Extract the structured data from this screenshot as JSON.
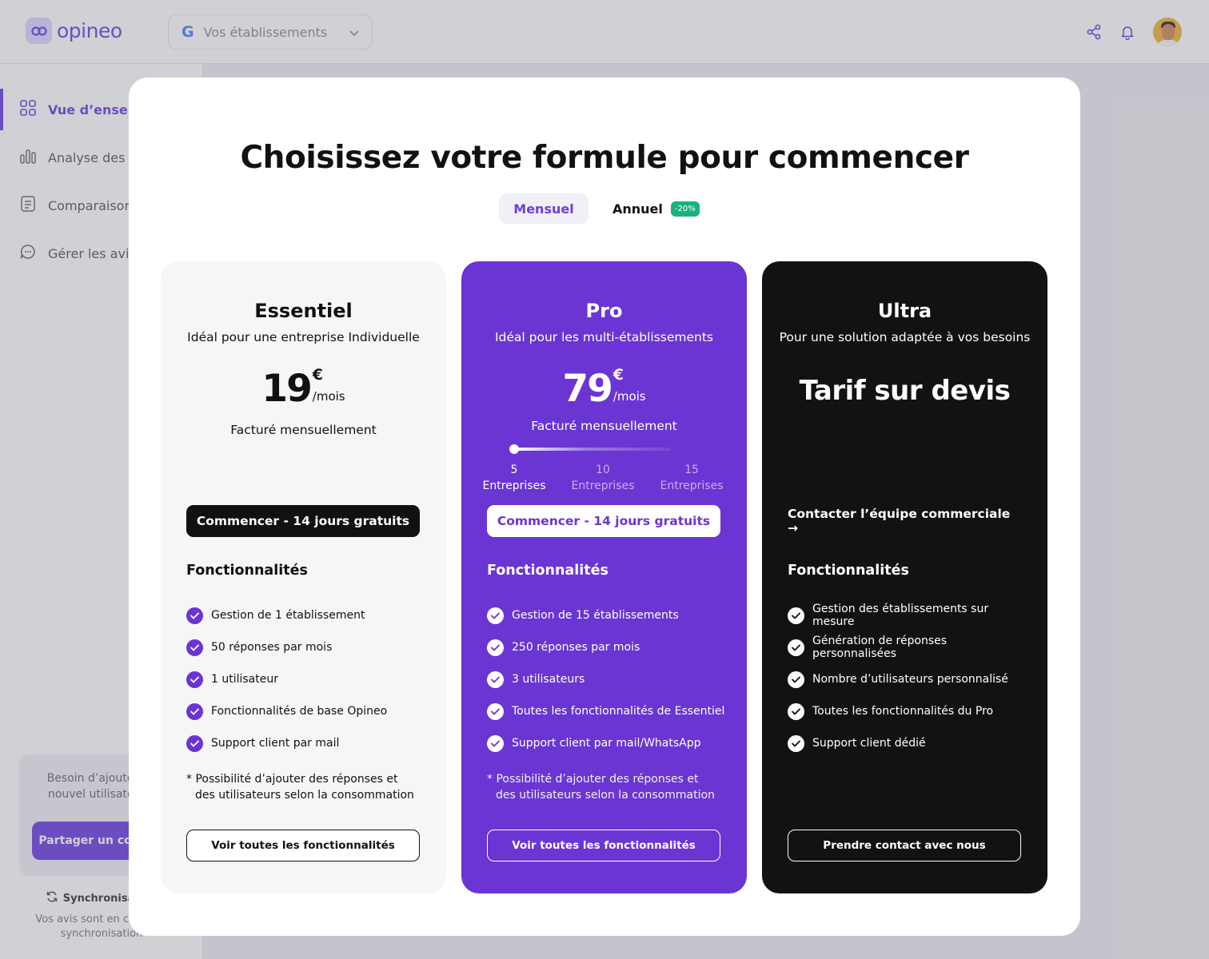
{
  "app": {
    "logo_text": "opineo",
    "establishment_select": {
      "placeholder": "Vos établissements",
      "icon": "google-icon"
    },
    "sidebar": {
      "items": [
        {
          "label": "Vue d’ensemble",
          "icon": "grid-icon",
          "active": true
        },
        {
          "label": "Analyse des avis",
          "icon": "bar-chart-icon",
          "active": false
        },
        {
          "label": "Comparaison",
          "icon": "document-icon",
          "active": false
        },
        {
          "label": "Gérer les avis",
          "icon": "chat-icon",
          "active": false
        }
      ],
      "help_card": {
        "text": "Besoin d’ajouter un nouvel utilisateur ?",
        "button": "Partager un compte"
      },
      "sync": {
        "title": "Synchronisation",
        "text": "Vos avis sont en cours de synchronisation"
      }
    }
  },
  "modal": {
    "title": "Choisissez votre formule pour commencer",
    "billing_toggle": {
      "monthly": "Mensuel",
      "yearly": "Annuel",
      "yearly_badge": "-20%",
      "selected": "Mensuel"
    },
    "plans": [
      {
        "name": "Essentiel",
        "description": "Idéal pour une entreprise Individuelle",
        "price": "19",
        "currency": "€",
        "period": "/mois",
        "billing": "Facturé mensuellement",
        "cta": "Commencer - 14 jours gratuits",
        "features_title": "Fonctionnalités",
        "features": [
          "Gestion de 1 établissement",
          "50 réponses par mois",
          "1 utilisateur",
          "Fonctionnalités de base Opineo",
          "Support client par mail"
        ],
        "note": "* Possibilité d’ajouter des réponses et des utilisateurs selon la consommation",
        "bottom_button": "Voir toutes les fonctionnalités"
      },
      {
        "name": "Pro",
        "description": "Idéal pour les multi-établissements",
        "price": "79",
        "currency": "€",
        "period": "/mois",
        "billing": "Facturé mensuellement",
        "slider": {
          "ticks": [
            {
              "value": "5",
              "label": "Entreprises"
            },
            {
              "value": "10",
              "label": "Entreprises"
            },
            {
              "value": "15",
              "label": "Entreprises"
            }
          ],
          "selected_index": 0
        },
        "cta": "Commencer - 14 jours gratuits",
        "features_title": "Fonctionnalités",
        "features": [
          "Gestion de 15 établissements",
          "250 réponses par mois",
          "3 utilisateurs",
          "Toutes les fonctionnalités de Essentiel",
          "Support client par mail/WhatsApp"
        ],
        "note": "* Possibilité d’ajouter des réponses et des utilisateurs selon la consommation",
        "bottom_button": "Voir toutes les fonctionnalités"
      },
      {
        "name": "Ultra",
        "description": "Pour une solution adaptée à vos besoins",
        "price_text": "Tarif sur devis",
        "cta": "Contacter l’équipe commerciale →",
        "features_title": "Fonctionnalités",
        "features": [
          "Gestion des établissements sur mesure",
          "Génération de réponses personnalisées",
          "Nombre d’utilisateurs personnalisé",
          "Toutes les fonctionnalités du Pro",
          "Support client dédié"
        ],
        "bottom_button": "Prendre contact avec nous"
      }
    ]
  },
  "colors": {
    "brand": "#6b35d3",
    "badge_green": "#16b47a",
    "ultra_bg": "#121212",
    "essentiel_bg": "#f6f6f7"
  }
}
